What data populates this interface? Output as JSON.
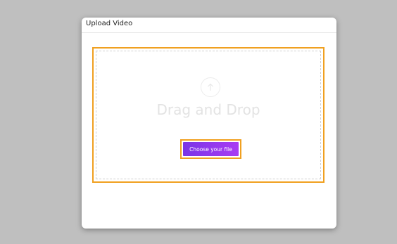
{
  "modal": {
    "title": "Upload Video"
  },
  "dropzone": {
    "icon": "upload-arrow-icon",
    "label": "Drag and Drop",
    "button_label": "Choose your file"
  },
  "colors": {
    "background": "#bfbfbf",
    "highlight_outline": "#f0a020",
    "button_gradient_start": "#7a35e6",
    "button_gradient_end": "#a93cf3"
  }
}
